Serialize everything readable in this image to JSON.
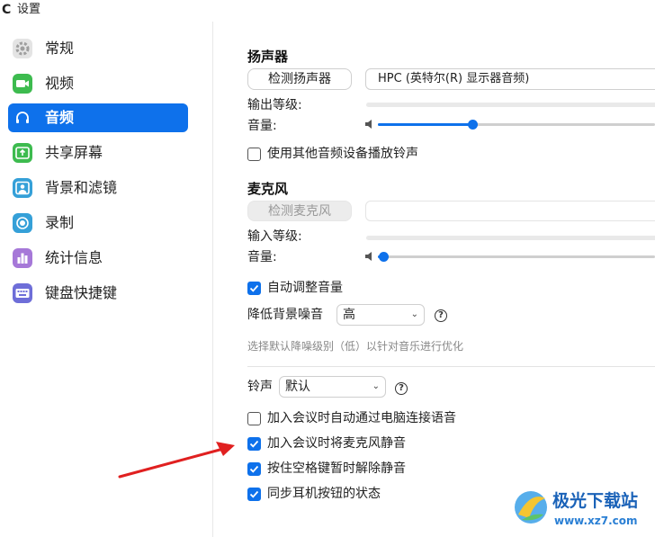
{
  "window": {
    "title": "设置",
    "app_icon": "zoom-app-icon"
  },
  "sidebar": {
    "items": [
      {
        "label": "常规",
        "icon": "gear-icon",
        "color": "#9e9e9e",
        "active": false
      },
      {
        "label": "视频",
        "icon": "video-camera-icon",
        "color": "#3dbb4f",
        "active": false
      },
      {
        "label": "音频",
        "icon": "headphones-icon",
        "color": "#0e71eb",
        "active": true
      },
      {
        "label": "共享屏幕",
        "icon": "share-screen-icon",
        "color": "#3dbb4f",
        "active": false
      },
      {
        "label": "背景和滤镜",
        "icon": "person-background-icon",
        "color": "#35a0d8",
        "active": false
      },
      {
        "label": "录制",
        "icon": "record-icon",
        "color": "#35a0d8",
        "active": false
      },
      {
        "label": "统计信息",
        "icon": "stats-icon",
        "color": "#a678d8",
        "active": false
      },
      {
        "label": "键盘快捷键",
        "icon": "keyboard-icon",
        "color": "#6e6ed8",
        "active": false
      }
    ]
  },
  "speaker": {
    "title": "扬声器",
    "test_button": "检测扬声器",
    "device": "HPC (英特尔(R) 显示器音频)",
    "output_level_label": "输出等级:",
    "volume_label": "音量:",
    "volume": 0.34,
    "use_other_device_label": "使用其他音频设备播放铃声",
    "use_other_device_checked": false
  },
  "microphone": {
    "title": "麦克风",
    "test_button": "检测麦克风",
    "device": "",
    "input_level_label": "输入等级:",
    "volume_label": "音量:",
    "volume": 0.02,
    "auto_adjust_label": "自动调整音量",
    "auto_adjust_checked": true,
    "noise_label": "降低背景噪音",
    "noise_value": "高",
    "noise_hint": "选择默认降噪级别（低）以针对音乐进行优化"
  },
  "ringtone": {
    "label": "铃声",
    "value": "默认"
  },
  "options": [
    {
      "label": "加入会议时自动通过电脑连接语音",
      "checked": false
    },
    {
      "label": "加入会议时将麦克风静音",
      "checked": true
    },
    {
      "label": "按住空格键暂时解除静音",
      "checked": true
    },
    {
      "label": "同步耳机按钮的状态",
      "checked": true
    }
  ],
  "watermark": {
    "name": "极光下载站",
    "url": "www.xz7.com"
  },
  "colors": {
    "accent": "#0e71eb",
    "arrow": "#e02020"
  }
}
